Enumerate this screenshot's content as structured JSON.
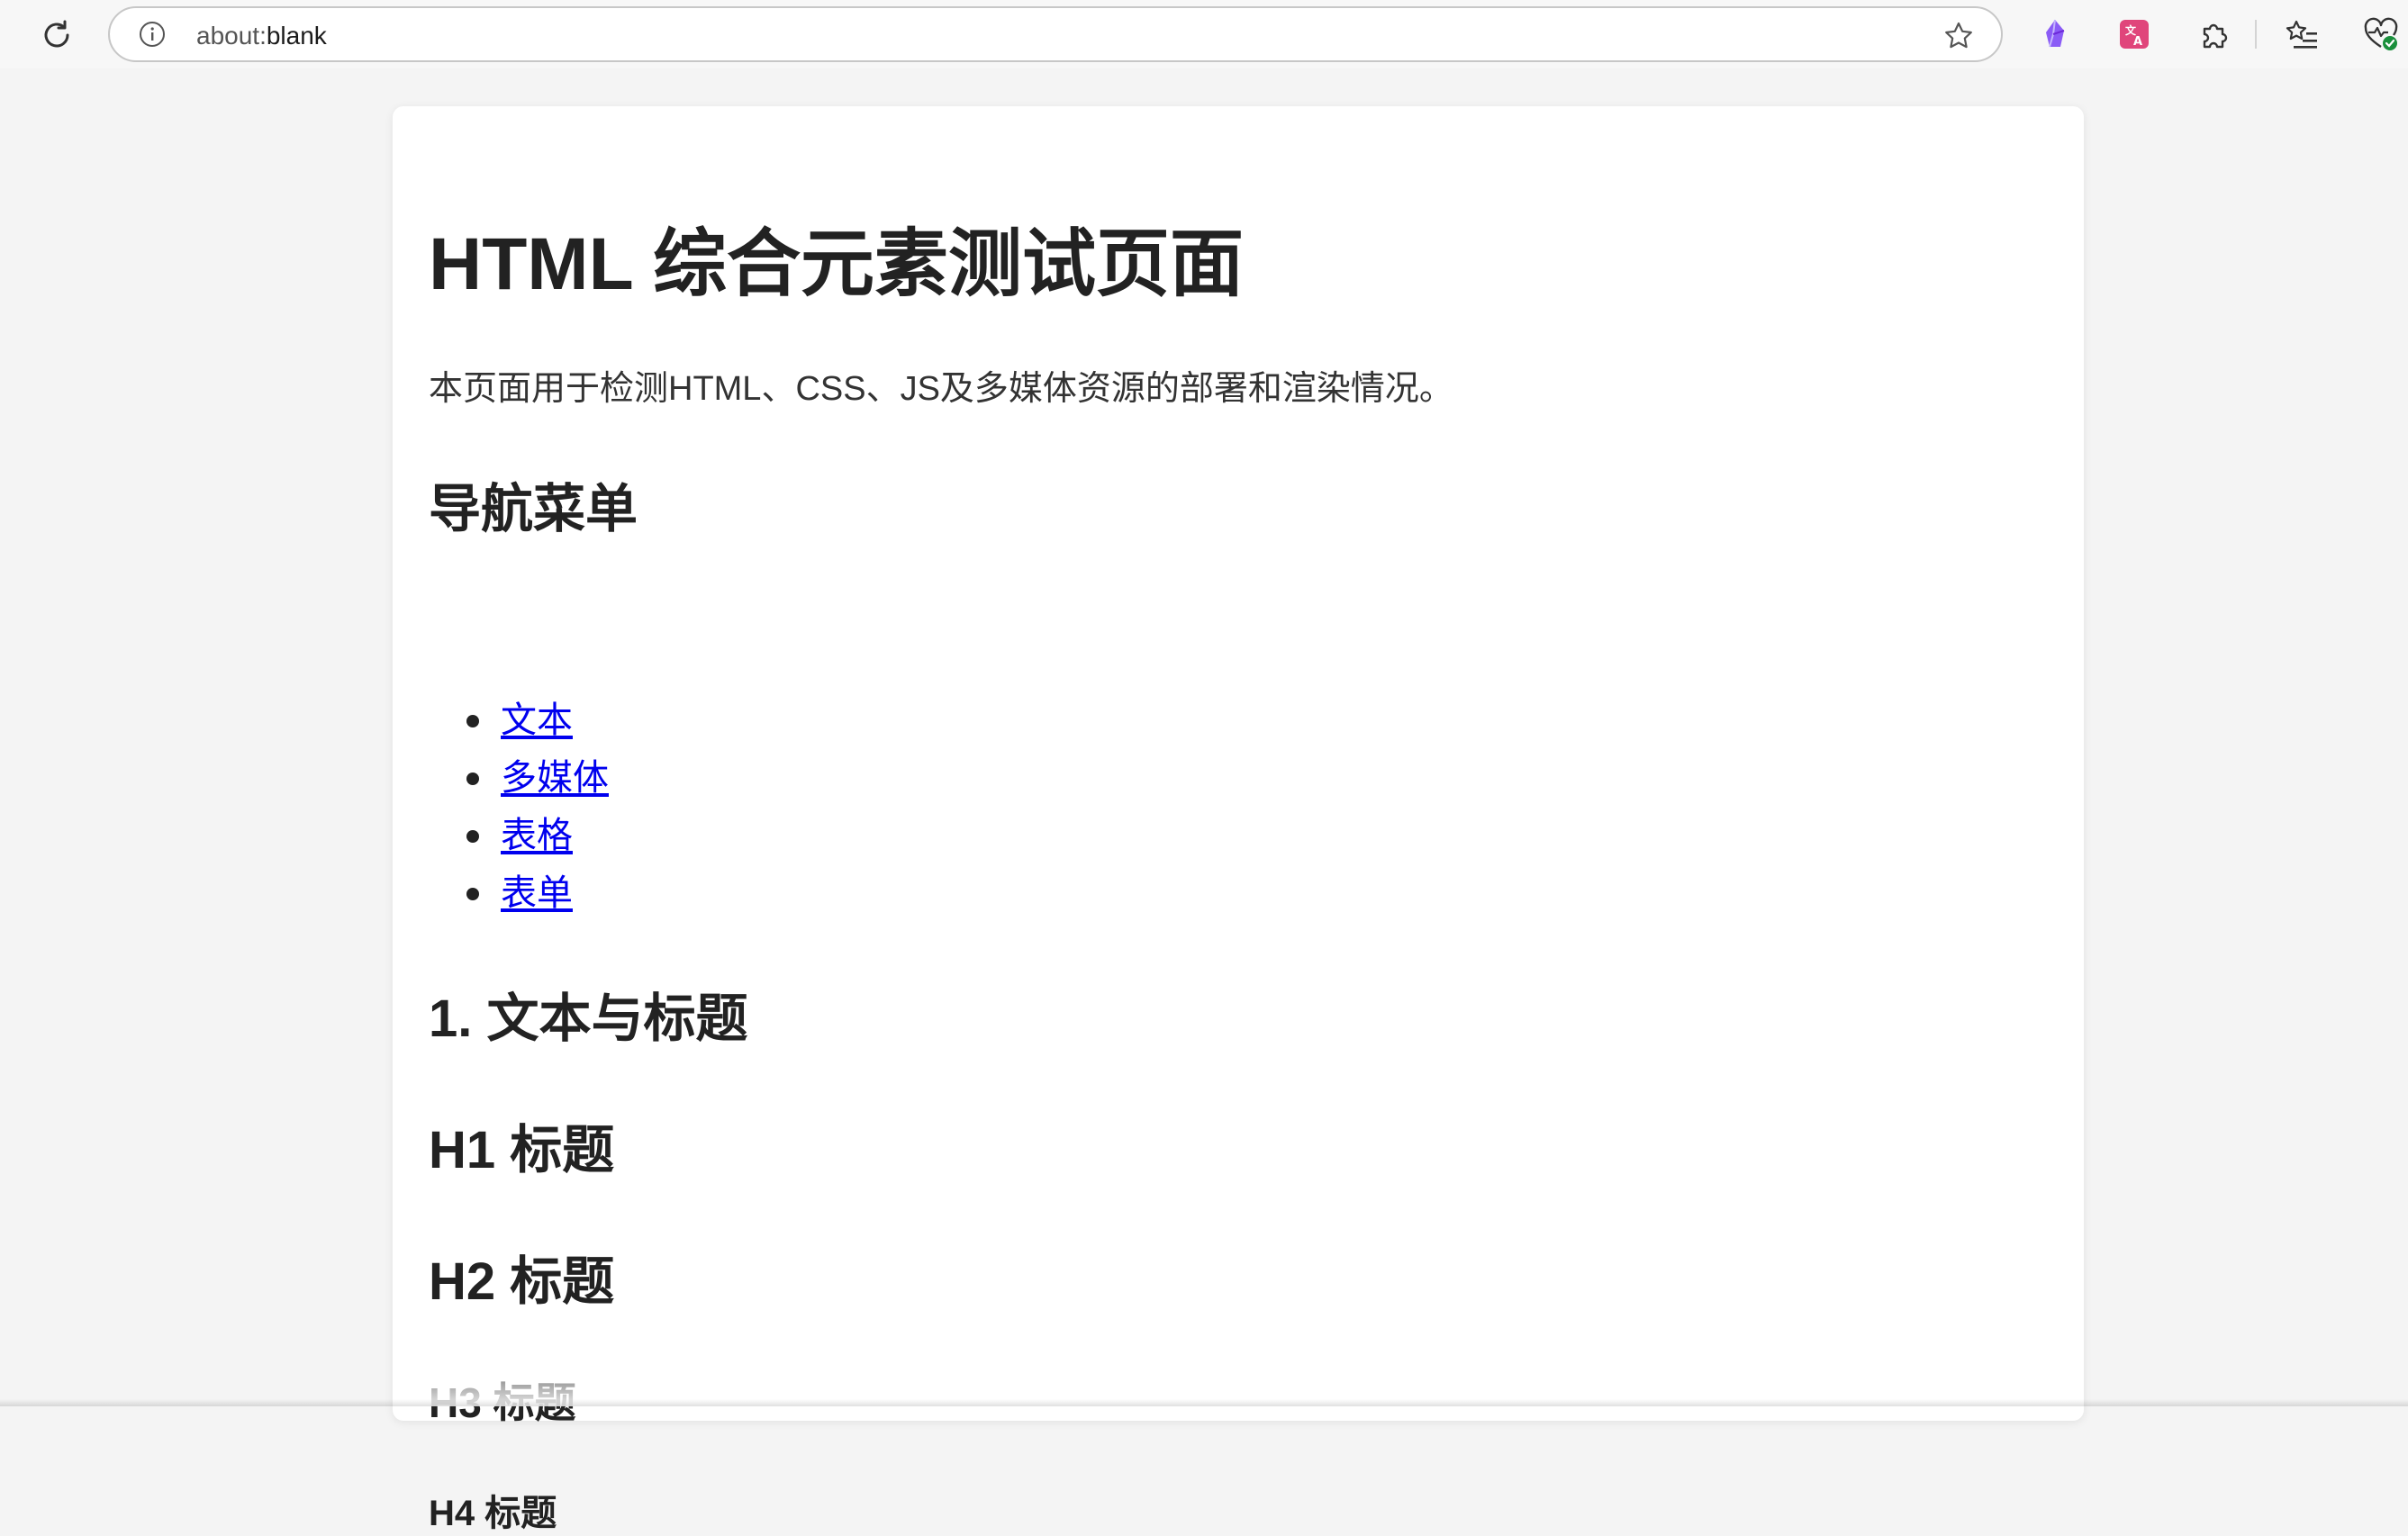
{
  "browser": {
    "url_scheme": "about:",
    "url_host": "blank",
    "icons": {
      "reload": "reload-icon",
      "info": "info-icon",
      "bookmark": "star-icon",
      "ext1": "purple-crystal-extension-icon",
      "ext2": "translate-extension-icon",
      "extensions": "puzzle-icon",
      "favorites": "favorites-list-icon",
      "health": "browser-essentials-icon"
    },
    "colors": {
      "ext_purple": "#8b5cf6",
      "ext_pink": "#e0457b",
      "status_green": "#1a8f3c"
    }
  },
  "page": {
    "title": "HTML 综合元素测试页面",
    "intro": "本页面用于检测HTML、CSS、JS及多媒体资源的部署和渲染情况。",
    "nav_heading": "导航菜单",
    "nav_items": [
      {
        "label": "文本"
      },
      {
        "label": "多媒体"
      },
      {
        "label": "表格"
      },
      {
        "label": "表单"
      }
    ],
    "section1_heading": "1. 文本与标题",
    "h1_sample": "H1 标题",
    "h2_sample": "H2 标题",
    "h3_sample": "H3 标题",
    "h4_sample": "H4 标题"
  }
}
